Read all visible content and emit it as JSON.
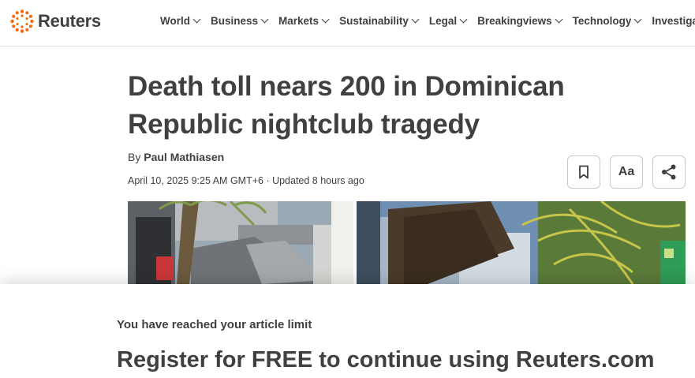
{
  "brand": {
    "name": "Reuters",
    "accent": "#fa6400"
  },
  "nav": {
    "items": [
      {
        "label": "World"
      },
      {
        "label": "Business"
      },
      {
        "label": "Markets"
      },
      {
        "label": "Sustainability"
      },
      {
        "label": "Legal"
      },
      {
        "label": "Breakingviews"
      },
      {
        "label": "Technology"
      },
      {
        "label": "Investigat"
      }
    ]
  },
  "article": {
    "headline": "Death toll nears 200 in Dominican Republic nightclub tragedy",
    "byline_prefix": "By",
    "author": "Paul Mathiasen",
    "dateline": "April 10, 2025 9:25 AM GMT+6 · Updated 8 hours ago",
    "tools": {
      "save_icon": "bookmark-icon",
      "text_size_label": "Aa",
      "share_icon": "share-icon"
    }
  },
  "paywall": {
    "limit_text": "You have reached your article limit",
    "register_text": "Register for FREE to continue using Reuters.com"
  }
}
